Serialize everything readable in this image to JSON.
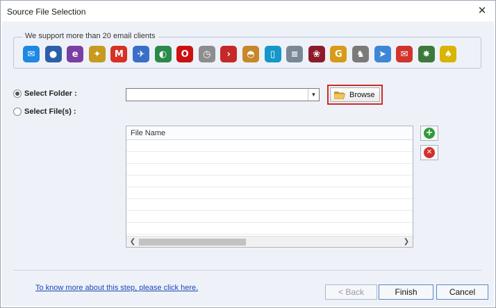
{
  "window": {
    "title": "Source File Selection",
    "close_glyph": "✕"
  },
  "clients": {
    "legend": "We support more than 20 email clients",
    "icons": [
      {
        "name": "mail-icon",
        "glyph": "✉",
        "color": "#1e88e5"
      },
      {
        "name": "thunderbird-icon",
        "glyph": "●",
        "color": "#2d5fa8"
      },
      {
        "name": "eudora-icon",
        "glyph": "e",
        "color": "#7b3fa3"
      },
      {
        "name": "pocomail-icon",
        "glyph": "✦",
        "color": "#c89a1f"
      },
      {
        "name": "gmail-icon",
        "glyph": "M",
        "color": "#d93025"
      },
      {
        "name": "postbox-icon",
        "glyph": "✈",
        "color": "#3a6fc9"
      },
      {
        "name": "claws-icon",
        "glyph": "◐",
        "color": "#2a8a4a"
      },
      {
        "name": "opera-icon",
        "glyph": "O",
        "color": "#cc1111"
      },
      {
        "name": "clock-mail-icon",
        "glyph": "◷",
        "color": "#8d8d8d"
      },
      {
        "name": "red-arrow-icon",
        "glyph": "›",
        "color": "#c62828"
      },
      {
        "name": "sunset-icon",
        "glyph": "◓",
        "color": "#c8872a"
      },
      {
        "name": "bluemail-icon",
        "glyph": "▯",
        "color": "#1597c9"
      },
      {
        "name": "notes-icon",
        "glyph": "≡",
        "color": "#7a8896"
      },
      {
        "name": "grapes-icon",
        "glyph": "❀",
        "color": "#8e1b2a"
      },
      {
        "name": "g-icon",
        "glyph": "G",
        "color": "#d89b18"
      },
      {
        "name": "gnu-icon",
        "glyph": "♞",
        "color": "#7a7a7a"
      },
      {
        "name": "send-icon",
        "glyph": "➤",
        "color": "#3d87d6"
      },
      {
        "name": "envelope-icon",
        "glyph": "✉",
        "color": "#d0342c"
      },
      {
        "name": "evolution-icon",
        "glyph": "✸",
        "color": "#3b7a3b"
      },
      {
        "name": "bat-icon",
        "glyph": "♠",
        "color": "#d9b400"
      }
    ]
  },
  "select_folder": {
    "label": "Select Folder :",
    "value": "",
    "browse_label": "Browse"
  },
  "select_files": {
    "label": "Select File(s) :"
  },
  "file_list": {
    "column_header": "File Name",
    "rows": [
      "",
      "",
      "",
      "",
      "",
      "",
      "",
      ""
    ]
  },
  "side_buttons": {
    "add_glyph": "+",
    "remove_glyph": "✕"
  },
  "footer": {
    "help_link": "To know more about this step, please click here.",
    "back_label": "< Back",
    "finish_label": "Finish",
    "cancel_label": "Cancel"
  },
  "colors": {
    "highlight_outline": "#cc2a2a",
    "link": "#1a47b8",
    "add": "#2e9b3a",
    "remove": "#d32f2f"
  }
}
